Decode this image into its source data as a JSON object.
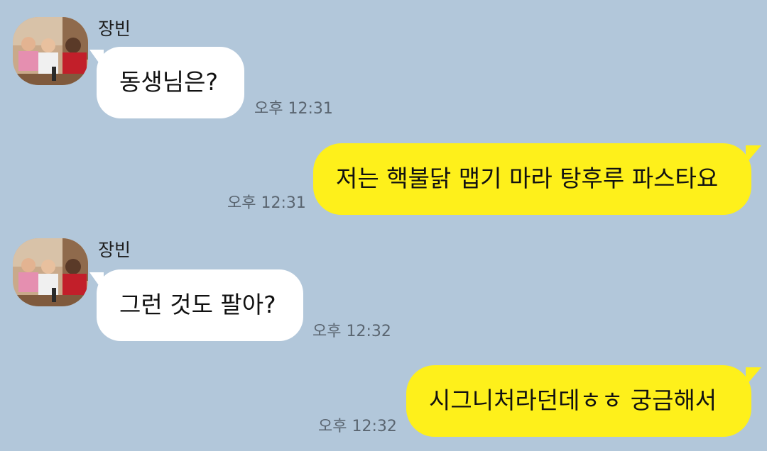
{
  "messages": [
    {
      "sender": "장빈",
      "text": "동생님은?",
      "time": "오후 12:31"
    },
    {
      "text": "저는 핵불닭 맵기 마라 탕후루 파스타요",
      "time": "오후 12:31"
    },
    {
      "sender": "장빈",
      "text": "그런 것도 팔아?",
      "time": "오후 12:32"
    },
    {
      "text": "시그니처라던데ㅎㅎ 궁금해서",
      "time": "오후 12:32"
    }
  ],
  "colors": {
    "background": "#b2c7da",
    "incoming_bubble": "#ffffff",
    "outgoing_bubble": "#fef01b"
  }
}
